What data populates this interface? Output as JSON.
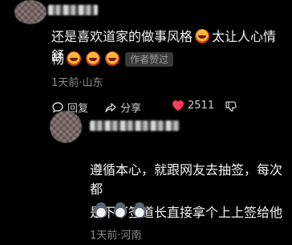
{
  "comment": {
    "text_line1": "还是喜欢道家的做事风格",
    "text_line1_suffix": "太让人心情舒",
    "text_line2": "畅",
    "badge": "作者赞过",
    "meta": "1天前·山东",
    "actions": {
      "reply_label": "回复",
      "share_label": "分享",
      "like_count": "2511"
    }
  },
  "reply": {
    "text_line1": "遵循本心，就跟网友去抽签，每次都",
    "text_line2": "是下下签道长直接拿个上上签给他",
    "meta": "1天前·河南"
  },
  "colors": {
    "background": "#000000",
    "like_heart": "#ff3b5c",
    "meta_text": "#8b8b8b"
  }
}
